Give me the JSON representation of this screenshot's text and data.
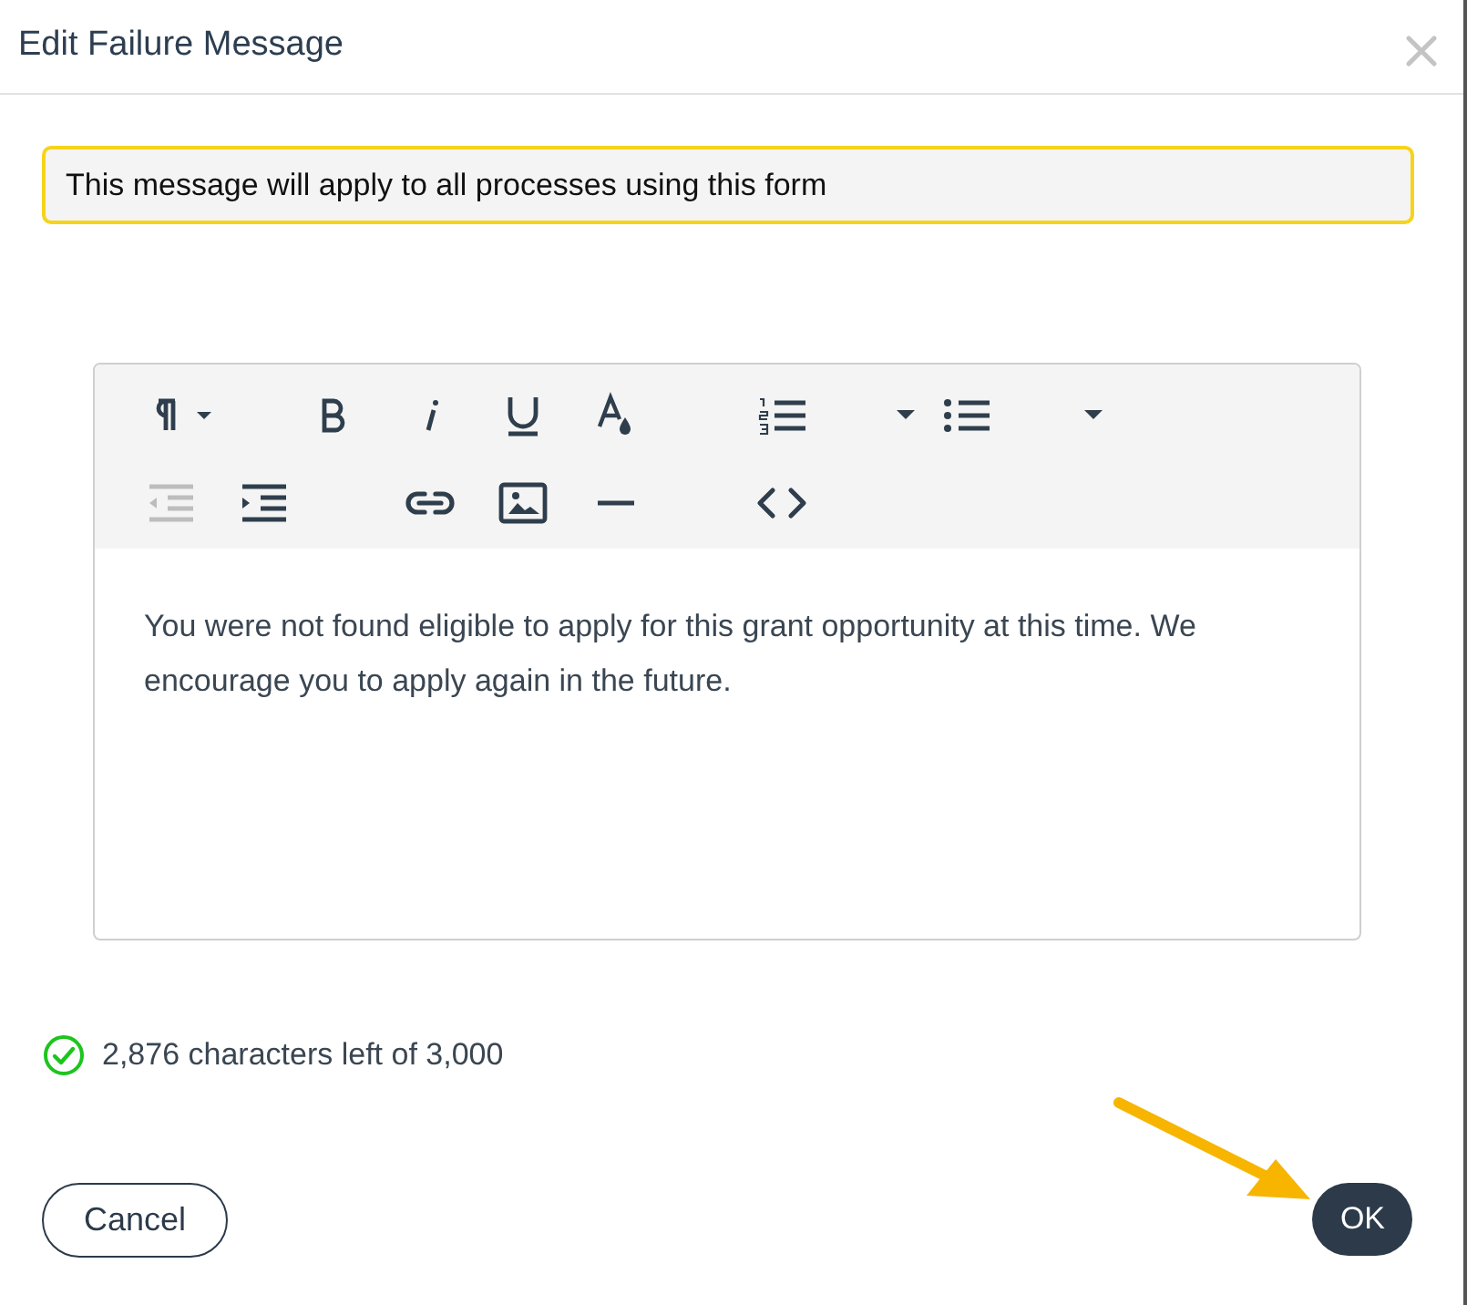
{
  "dialog": {
    "title": "Edit Failure Message"
  },
  "notice": "This message will apply to all processes using this form",
  "toolbar": {
    "rows": [
      [
        {
          "kind": "paragraph",
          "disabled": false
        },
        {
          "kind": "bold",
          "disabled": false
        },
        {
          "kind": "italic",
          "disabled": false
        },
        {
          "kind": "underline",
          "disabled": false
        },
        {
          "kind": "color",
          "disabled": false
        },
        {
          "kind": "ordered-list",
          "disabled": false
        },
        {
          "kind": "caret",
          "disabled": false
        },
        {
          "kind": "bullet-list",
          "disabled": false
        },
        {
          "kind": "caret",
          "disabled": false
        }
      ],
      [
        {
          "kind": "outdent",
          "disabled": true
        },
        {
          "kind": "indent",
          "disabled": false
        },
        {
          "kind": "link",
          "disabled": false
        },
        {
          "kind": "image",
          "disabled": false
        },
        {
          "kind": "rule",
          "disabled": false
        },
        {
          "kind": "code",
          "disabled": false
        }
      ]
    ]
  },
  "editor": {
    "value": "You were not found eligible to apply for this grant opportunity at this time. We encourage you to apply again in the future."
  },
  "counter": {
    "valid": true,
    "text": "2,876 characters left of 3,000"
  },
  "buttons": [
    {
      "kind": "secondary",
      "label": "Cancel"
    },
    {
      "kind": "primary",
      "label": "OK"
    }
  ]
}
